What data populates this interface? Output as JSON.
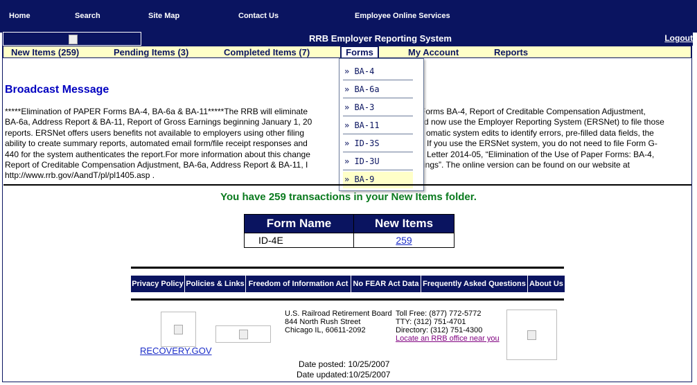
{
  "top_nav": [
    "Home",
    "Search",
    "Site Map",
    "Contact Us",
    "Employee Online Services"
  ],
  "header": {
    "title": "RRB Employer Reporting System",
    "logout": "Logout"
  },
  "tabs": {
    "new_items": "New Items (259)",
    "pending_items": "Pending Items (3)",
    "completed_items": "Completed Items (7)",
    "forms": "Forms",
    "my_account": "My Account",
    "reports": "Reports"
  },
  "forms_menu": [
    "» BA-4",
    "» BA-6a",
    "» BA-3",
    "» BA-11",
    "» ID-3S",
    "» ID-3U",
    "» BA-9"
  ],
  "broadcast": {
    "heading": "Broadcast Message",
    "line1": "*****Elimination of PAPER Forms BA-4, BA-6a & BA-11*****The RRB will eliminate",
    "line1b": "Forms BA-4, Report of Creditable Compensation Adjustment,",
    "line2": "BA-6a, Address Report & BA-11, Report of Gross Earnings beginning January 1, 20",
    "line2b": "d now use the Employer Reporting System (ERSNet) to file those",
    "line3": "reports. ERSNet offers users benefits not available to employers using other filing",
    "line3b": "omatic system edits to identify errors, pre-filled data fields, the",
    "line4": "ability to create summary reports, automated email form/file receipt responses and",
    "line4b": "If you use the ERSNet system, you do not need to file Form G-",
    "line5": "440 for the system authenticates the report.For more information about this change",
    "line5b": "Letter 2014-05, “Elimination of the Use of Paper Forms: BA-4,",
    "line6": "Report of Creditable Compensation Adjustment, BA-6a, Address Report & BA-11, I",
    "line6b": "ings”. The online version can be found on our website at",
    "line7": "http://www.rrb.gov/AandT/pl/pl1405.asp ."
  },
  "transactions_message": "You have 259 transactions in your New Items folder.",
  "items_table": {
    "headers": [
      "Form Name",
      "New Items"
    ],
    "rows": [
      {
        "form": "ID-4E",
        "count": "259"
      }
    ]
  },
  "footer_links": [
    "Privacy Policy",
    "Policies & Links",
    "Freedom of Information Act",
    "No FEAR Act Data",
    "Frequently Asked Questions",
    "About Us"
  ],
  "recovery_link": "RECOVERY.GOV",
  "address": [
    "U.S. Railroad Retirement Board",
    "844 North Rush Street",
    "Chicago IL, 60611-2092"
  ],
  "contact": {
    "toll_free": "Toll Free: (877) 772-5772",
    "tty": "TTY: (312) 751-4701",
    "directory": "Directory: (312) 751-4300",
    "locate": "Locate an RRB office near you"
  },
  "dates": {
    "posted": "Date posted:  10/25/2007",
    "updated": "Date updated:10/25/2007"
  }
}
